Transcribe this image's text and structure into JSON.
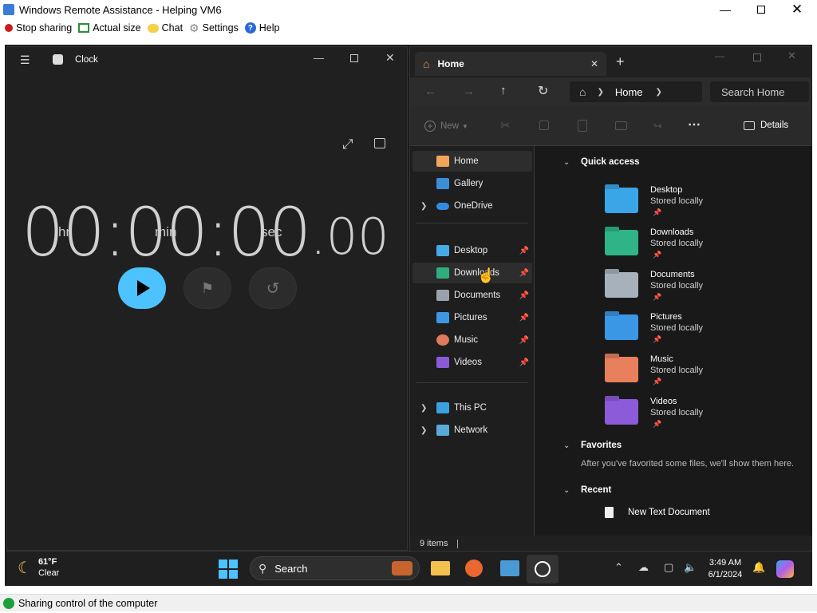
{
  "app": {
    "title": "Windows Remote Assistance - Helping VM6"
  },
  "toolbar": {
    "stop_sharing": "Stop sharing",
    "actual_size": "Actual size",
    "chat": "Chat",
    "settings": "Settings",
    "help": "Help"
  },
  "clock": {
    "title": "Clock",
    "time_main": "00:00:00",
    "time_fraction": ".00",
    "units": {
      "hr": "hr",
      "min": "min",
      "sec": "sec"
    }
  },
  "explorer": {
    "tab_label": "Home",
    "breadcrumb": "Home",
    "search_placeholder": "Search Home",
    "new_label": "New",
    "details_label": "Details",
    "sidebar": {
      "home": "Home",
      "gallery": "Gallery",
      "onedrive": "OneDrive",
      "desktop": "Desktop",
      "downloads": "Downloads",
      "documents": "Documents",
      "pictures": "Pictures",
      "music": "Music",
      "videos": "Videos",
      "this_pc": "This PC",
      "network": "Network"
    },
    "quick_access_title": "Quick access",
    "quick_access": [
      {
        "name": "Desktop",
        "status": "Stored locally"
      },
      {
        "name": "Downloads",
        "status": "Stored locally"
      },
      {
        "name": "Documents",
        "status": "Stored locally"
      },
      {
        "name": "Pictures",
        "status": "Stored locally"
      },
      {
        "name": "Music",
        "status": "Stored locally"
      },
      {
        "name": "Videos",
        "status": "Stored locally"
      }
    ],
    "favorites_title": "Favorites",
    "favorites_empty": "After you've favorited some files, we'll show them here.",
    "recent_title": "Recent",
    "recent_items": [
      "New Text Document"
    ],
    "status_items": "9 items"
  },
  "taskbar": {
    "temperature": "61°F",
    "condition": "Clear",
    "search_label": "Search",
    "time": "3:49 AM",
    "date": "6/1/2024"
  },
  "statusbar": {
    "text": "Sharing control of the computer"
  },
  "colors": {
    "accent": "#4cc2ff",
    "green": "#1e9f3a",
    "red": "#d11818"
  }
}
